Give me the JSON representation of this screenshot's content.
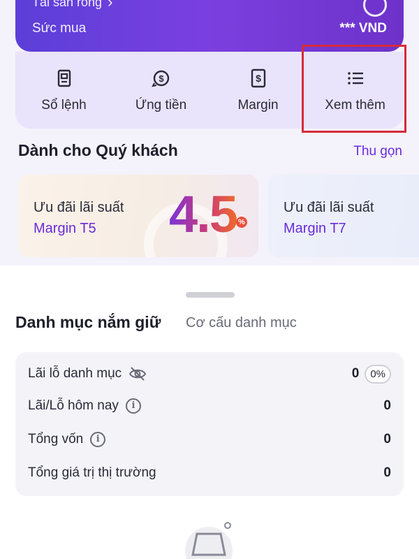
{
  "account": {
    "assets_label": "Tài sản ròng",
    "buying_power_label": "Sức mua",
    "buying_power_value": "*** VND"
  },
  "quick_actions": [
    {
      "label": "Sổ lệnh",
      "icon": "order-book-icon"
    },
    {
      "label": "Ứng tiền",
      "icon": "cash-advance-icon"
    },
    {
      "label": "Margin",
      "icon": "margin-icon"
    },
    {
      "label": "Xem thêm",
      "icon": "list-icon"
    }
  ],
  "for_you": {
    "title": "Dành cho Quý khách",
    "collapse_label": "Thu gọn",
    "promos": [
      {
        "line1": "Ưu đãi lãi suất",
        "line2": "Margin T5",
        "rate": "4.5",
        "rate_unit": "%"
      },
      {
        "line1": "Ưu đãi lãi suất",
        "line2": "Margin T7"
      }
    ]
  },
  "portfolio": {
    "tab_holdings": "Danh mục nắm giữ",
    "tab_structure": "Cơ cấu danh mục",
    "rows": [
      {
        "label": "Lãi lỗ danh mục",
        "value": "0",
        "pct": "0%"
      },
      {
        "label": "Lãi/Lỗ hôm nay",
        "value": "0"
      },
      {
        "label": "Tổng vốn",
        "value": "0"
      },
      {
        "label": "Tổng giá trị thị trường",
        "value": "0"
      }
    ]
  },
  "colors": {
    "accent": "#6a2bd9",
    "highlight": "#d42b3a"
  }
}
